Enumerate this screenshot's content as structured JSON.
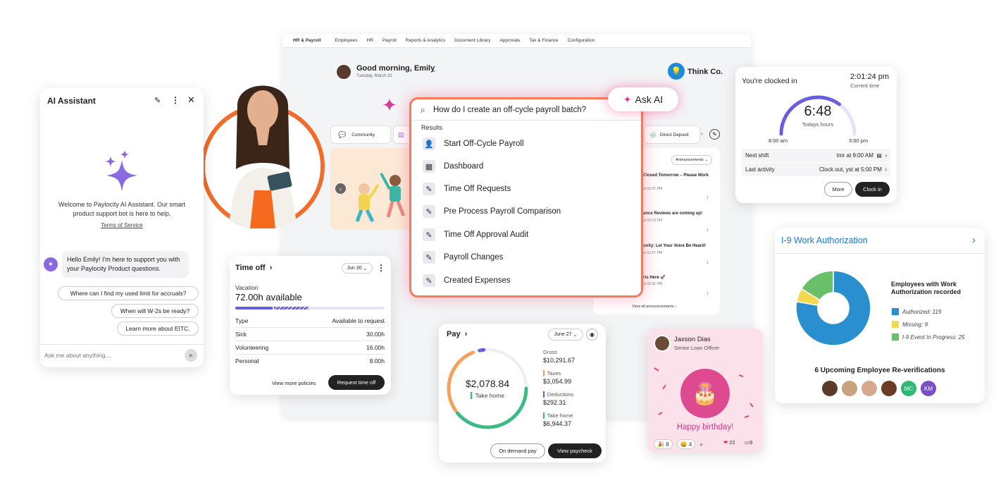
{
  "nav": {
    "brand": "HR & Payroll",
    "items": [
      "Employees",
      "HR",
      "Payroll",
      "Reports & Analytics",
      "Document Library",
      "Approvals",
      "Tax & Finance",
      "Configuration"
    ]
  },
  "greeting": {
    "title": "Good morning, Emily",
    "date": "Tuesday, March 31"
  },
  "company": {
    "name": "Think Co."
  },
  "quicklinks": {
    "community": "Community",
    "direct_deposit": "Direct Deposit"
  },
  "announcements": {
    "filter": "Announcements",
    "items": [
      {
        "title": "Closed Tomorrow – Please Work",
        "time": "at 03:37 PM",
        "count": "1"
      },
      {
        "title": "ance Reviews are coming up!",
        "time": "at 03:13 PM",
        "count": "1"
      },
      {
        "title": "unity: Let Your Voice Be Heard!",
        "time": "at 12:57 PM",
        "count": "1"
      },
      {
        "title": "rts Here 🚀",
        "time": "at 02:41 PM",
        "count": "1"
      }
    ],
    "view_all": "View all announcements"
  },
  "ask_ai": {
    "badge": "Ask AI",
    "query": "How do I create an off-cycle payroll batch?",
    "results_label": "Results",
    "results": [
      {
        "label": "Start Off-Cycle Payroll",
        "icon": "person-icon"
      },
      {
        "label": "Dashboard",
        "icon": "calculator-icon"
      },
      {
        "label": "Time Off Requests",
        "icon": "edit-doc-icon"
      },
      {
        "label": "Pre Process Payroll Comparison",
        "icon": "edit-doc-icon"
      },
      {
        "label": "Time Off Approval Audit",
        "icon": "edit-doc-icon"
      },
      {
        "label": "Payroll Changes",
        "icon": "edit-doc-icon"
      },
      {
        "label": "Created Expenses",
        "icon": "edit-doc-icon"
      }
    ]
  },
  "assistant": {
    "title": "AI Assistant",
    "welcome": "Welcome to Paylocity AI Assistant. Our smart product support bot is here to help.",
    "terms": "Terms of Service",
    "bot_message": "Hello Emily! I'm here to support you with your Paylocity Product questions.",
    "suggestions": [
      "Where can I find my used limit for accruals?",
      "When will W-2s be ready?",
      "Learn more about EITC."
    ],
    "input_placeholder": "Ask me about anything..."
  },
  "time_off": {
    "title": "Time off",
    "date_select": "Jun 30",
    "vacation_label": "Vacation",
    "vacation_available": "72.00h available",
    "vacation_used_fraction": 0.25,
    "vacation_pending_fraction": 0.23,
    "col_type": "Type",
    "col_available": "Available to request",
    "rows": [
      {
        "type": "Sick",
        "value": "30.00h"
      },
      {
        "type": "Volunteering",
        "value": "16.00h"
      },
      {
        "type": "Personal",
        "value": "8.00h"
      }
    ],
    "view_more": "View more policies",
    "request": "Request time off"
  },
  "pay": {
    "title": "Pay",
    "date_select": "June 27",
    "amount": "$2,078.84",
    "take_home_label": "Take home",
    "gross_label": "Gross",
    "gross": "$10,291.67",
    "taxes_label": "Taxes",
    "taxes": "$3,054.99",
    "deductions_label": "Deductions",
    "deductions": "$292.31",
    "takehome2_label": "Take home",
    "takehome2": "$6,944.37",
    "on_demand": "On demand pay",
    "view_paycheck": "View paycheck",
    "colors": {
      "takehome": "#3dbb85",
      "taxes": "#f4a15c",
      "deductions": "#6a5de0"
    }
  },
  "birthday": {
    "name": "Jaxson Dias",
    "role": "Senior Loan Officer",
    "message": "Happy birthday!",
    "reactions": {
      "party": "8",
      "laugh": "4",
      "heart": "22",
      "comments": "9"
    }
  },
  "clock": {
    "title": "You're clocked in",
    "time": "2:01:24 pm",
    "time_label": "Current time",
    "hours": "6:48",
    "hours_label": "Todays hours",
    "start": "8:00 am",
    "end": "3:00 pm",
    "progress_fraction": 0.7,
    "next_shift_label": "Next shift",
    "next_shift": "tmr at 9:00 AM",
    "last_activity_label": "Last activity",
    "last_activity": "Clock out, yst at 5:00 PM",
    "more": "More",
    "clock_in": "Clock in"
  },
  "i9": {
    "title": "I-9 Work Authorization",
    "chart_title": "Employees with Work Authorization recorded",
    "reverify": "6 Upcoming Employee Re-verifications",
    "avatars": [
      "MC",
      "KM"
    ],
    "legend": [
      {
        "label": "Authorized: 119",
        "color": "#2a8fcf"
      },
      {
        "label": "Missing: 9",
        "color": "#f2d94e"
      },
      {
        "label": "I-9 Event In Progress: 25",
        "color": "#6abf69"
      }
    ]
  },
  "chart_data": {
    "type": "pie",
    "title": "Employees with Work Authorization recorded",
    "categories": [
      "Authorized",
      "Missing",
      "I-9 Event In Progress"
    ],
    "values": [
      119,
      9,
      25
    ],
    "colors": [
      "#2a8fcf",
      "#f2d94e",
      "#6abf69"
    ],
    "legend": "right"
  }
}
